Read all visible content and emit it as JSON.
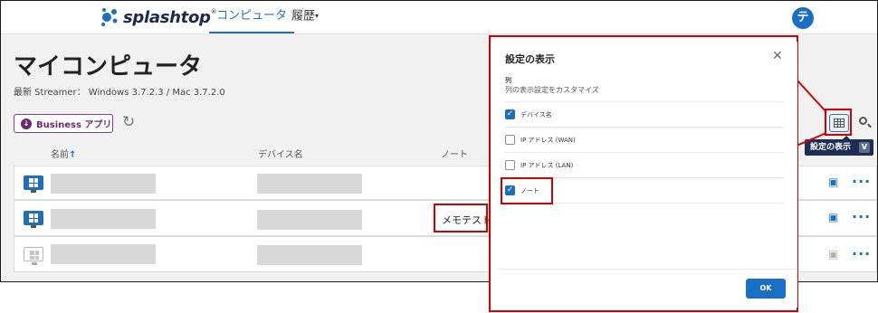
{
  "header": {
    "logo_text": "splashtop",
    "logo_mark": "®",
    "nav": [
      {
        "label": "コンピュータ",
        "active": true
      },
      {
        "label": "履歴",
        "dropdown": true
      }
    ],
    "avatar_initial": "テ"
  },
  "page": {
    "title": "マイコンピュータ",
    "streamer": "最新 Streamer：  Windows 3.7.2.3 / Mac 3.7.2.0",
    "business_app_label": "Business アプリ"
  },
  "table": {
    "columns": [
      "名前",
      "デバイス名",
      "ノート"
    ],
    "sort_arrow": "↑",
    "rows": [
      {
        "status": "online",
        "note": ""
      },
      {
        "status": "online",
        "note": "メモテスト"
      },
      {
        "status": "offline",
        "note": ""
      }
    ]
  },
  "toolbar": {
    "tooltip": "設定の表示",
    "tooltip_key": "V"
  },
  "dialog": {
    "title": "設定の表示",
    "section": "列",
    "subtitle": "列の表示設定をカスタマイズ",
    "options": [
      {
        "label": "デバイス名",
        "checked": true
      },
      {
        "label": "IP アドレス (WAN)",
        "checked": false
      },
      {
        "label": "IP アドレス (LAN)",
        "checked": false
      },
      {
        "label": "ノート",
        "checked": true
      }
    ],
    "ok_label": "OK"
  },
  "colors": {
    "accent": "#1a6fc4",
    "business": "#6b2a6b",
    "highlight": "#d40000",
    "tooltip_bg": "#1d2e52"
  }
}
